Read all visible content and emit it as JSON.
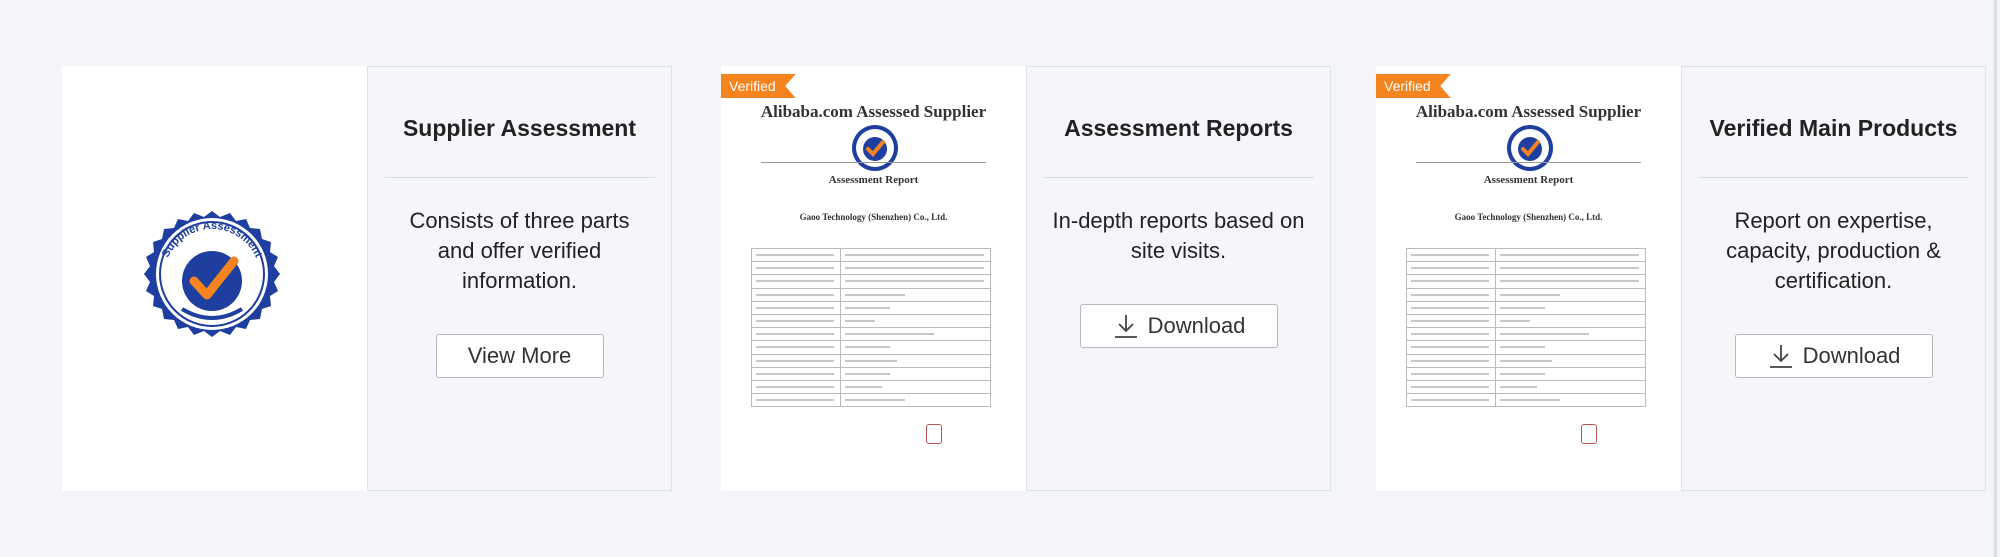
{
  "cards": [
    {
      "title": "Supplier Assessment",
      "description": "Consists of three parts and offer verified information.",
      "button_label": "View More",
      "seal_text": "Supplier Assessment"
    },
    {
      "title": "Assessment Reports",
      "description": "In-depth reports based on site visits.",
      "button_label": "Download",
      "badge": "Verified",
      "report_heading": "Alibaba.com Assessed Supplier",
      "report_subheading": "Assessment Report",
      "report_company": "Gaoo Technology (Shenzhen) Co., Ltd."
    },
    {
      "title": "Verified Main Products",
      "description": "Report on expertise, capacity, production & certification.",
      "button_label": "Download",
      "badge": "Verified",
      "report_heading": "Alibaba.com Assessed Supplier",
      "report_subheading": "Assessment Report",
      "report_company": "Gaoo Technology (Shenzhen) Co., Ltd."
    }
  ],
  "colors": {
    "badge_orange": "#f5841f",
    "seal_blue": "#1f3fa0",
    "check_orange": "#f5841f",
    "pane_bg": "#f5f6fa"
  }
}
